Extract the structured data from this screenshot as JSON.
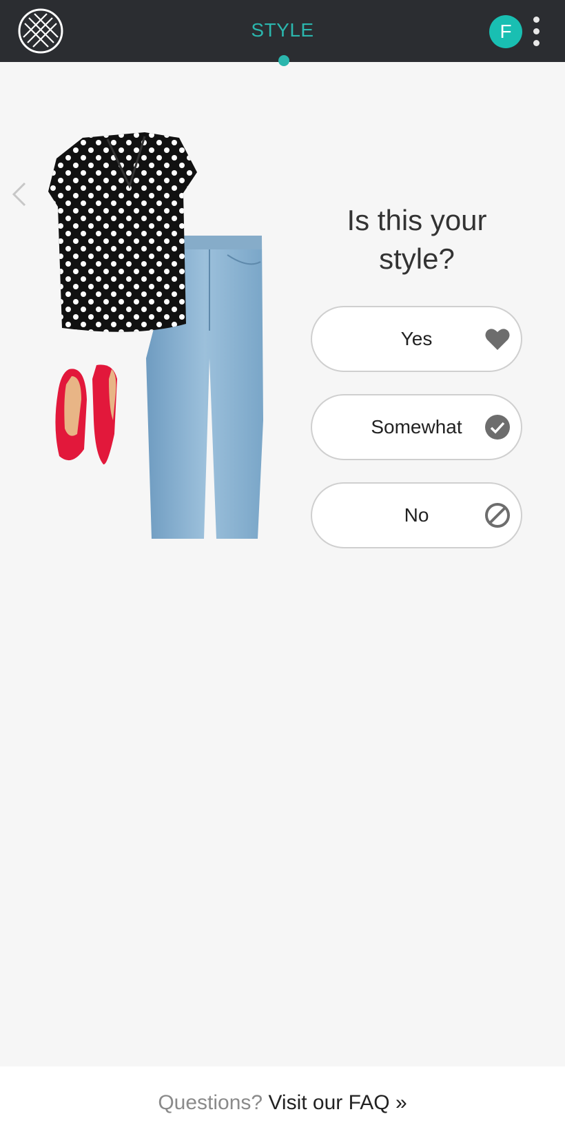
{
  "header": {
    "title": "STYLE",
    "avatar_initial": "F",
    "accent_color": "#2bb6ad",
    "logo_icon": "lattice-logo-icon",
    "menu_icon": "kebab-menu-icon"
  },
  "card": {
    "prev_icon": "chevron-left-icon",
    "outfit_items": [
      "polka-dot blouse",
      "light-wash jeans",
      "red flats"
    ]
  },
  "question": {
    "line1": "Is this your",
    "line2": "style?"
  },
  "answers": [
    {
      "label": "Yes",
      "icon": "heart-icon"
    },
    {
      "label": "Somewhat",
      "icon": "check-circle-icon"
    },
    {
      "label": "No",
      "icon": "ban-icon"
    }
  ],
  "footer": {
    "question": "Questions?",
    "link": "Visit our FAQ »"
  }
}
